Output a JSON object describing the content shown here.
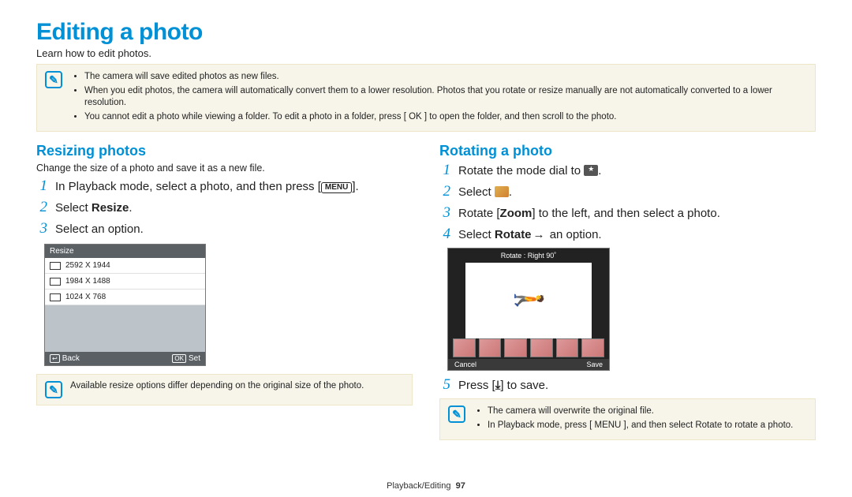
{
  "title": "Editing a photo",
  "subtitle": "Learn how to edit photos.",
  "top_notes": [
    "The camera will save edited photos as new files.",
    "When you edit photos, the camera will automatically convert them to a lower resolution. Photos that you rotate or resize manually are not automatically converted to a lower resolution.",
    "You cannot edit a photo while viewing a folder. To edit a photo in a folder, press [ OK ] to open the folder, and then scroll to the photo."
  ],
  "left": {
    "heading": "Resizing photos",
    "desc": "Change the size of a photo and save it as a new file.",
    "step1_pre": "In Playback mode, select a photo, and then press [",
    "menu_label": "MENU",
    "step1_post": "].",
    "step2_pre": "Select ",
    "step2_bold": "Resize",
    "step2_post": ".",
    "step3": "Select an option.",
    "ui_title": "Resize",
    "ui_rows": [
      "2592 X 1944",
      "1984 X 1488",
      "1024 X 768"
    ],
    "ui_back": "Back",
    "ui_set": "Set",
    "ui_ok": "OK",
    "note": "Available resize options differ depending on the original size of the photo."
  },
  "right": {
    "heading": "Rotating a photo",
    "step1_pre": "Rotate the mode dial to ",
    "step1_post": ".",
    "step2_pre": "Select ",
    "step2_post": ".",
    "step3_pre": "Rotate [",
    "step3_bold": "Zoom",
    "step3_post": "] to the left, and then select a photo.",
    "step4_pre": "Select ",
    "step4_bold": "Rotate",
    "step4_arrow": "→",
    "step4_post": " an option.",
    "ui_label": "Rotate : Right 90˚",
    "ui_cancel": "Cancel",
    "ui_save": "Save",
    "step5_pre": "Press [",
    "step5_post": "] to save.",
    "notes": [
      "The camera will overwrite the original file.",
      "In Playback mode, press [ MENU ], and then select Rotate to rotate a photo."
    ]
  },
  "footer_section": "Playback/Editing",
  "footer_page": "97"
}
